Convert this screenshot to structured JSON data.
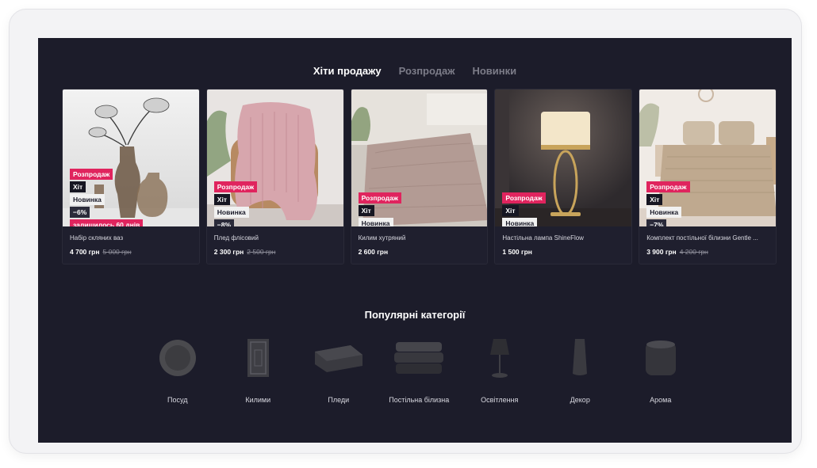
{
  "tabs": [
    {
      "label": "Хіти продажу",
      "active": true
    },
    {
      "label": "Розпродаж",
      "active": false
    },
    {
      "label": "Новинки",
      "active": false
    }
  ],
  "products": [
    {
      "name": "Набір скляних ваз",
      "price": "4 700 грн",
      "old_price": "5 000 грн",
      "badges": {
        "sale": "Розпродаж",
        "hit": "Хіт",
        "new": "Новинка",
        "discount": "−6%",
        "left": "залишилось 60 днів"
      }
    },
    {
      "name": "Плед флісовий",
      "price": "2 300 грн",
      "old_price": "2 500 грн",
      "badges": {
        "sale": "Розпродаж",
        "hit": "Хіт",
        "new": "Новинка",
        "discount": "−8%"
      }
    },
    {
      "name": "Килим хутряний",
      "price": "2 600 грн",
      "old_price": "",
      "badges": {
        "sale": "Розпродаж",
        "hit": "Хіт",
        "new": "Новинка"
      }
    },
    {
      "name": "Настільна лампа ShineFlow",
      "price": "1 500 грн",
      "old_price": "",
      "badges": {
        "sale": "Розпродаж",
        "hit": "Хіт",
        "new": "Новинка"
      }
    },
    {
      "name": "Комплект постільної білизни Gentle ...",
      "price": "3 900 грн",
      "old_price": "4 200 грн",
      "badges": {
        "sale": "Розпродаж",
        "hit": "Хіт",
        "new": "Новинка",
        "discount": "−7%"
      }
    }
  ],
  "categories_title": "Популярні категорії",
  "categories": [
    {
      "label": "Посуд",
      "icon": "plate-icon"
    },
    {
      "label": "Килими",
      "icon": "rug-icon"
    },
    {
      "label": "Пледи",
      "icon": "blanket-icon"
    },
    {
      "label": "Постільна білизна",
      "icon": "bedding-icon"
    },
    {
      "label": "Освітлення",
      "icon": "lamp-icon"
    },
    {
      "label": "Декор",
      "icon": "vase-icon"
    },
    {
      "label": "Арома",
      "icon": "candle-icon"
    }
  ],
  "colors": {
    "background": "#1c1c2a",
    "sale": "#e0245e",
    "hit": "#161622",
    "new": "#f1f1f1"
  }
}
